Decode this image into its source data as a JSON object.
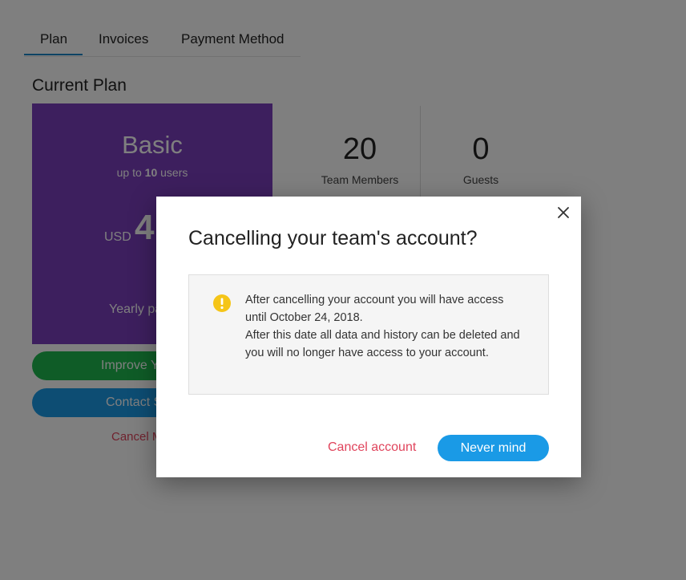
{
  "tabs": [
    {
      "label": "Plan",
      "active": true
    },
    {
      "label": "Invoices",
      "active": false
    },
    {
      "label": "Payment Method",
      "active": false
    }
  ],
  "section_title": "Current Plan",
  "plan": {
    "name": "Basic",
    "limit_prefix": "up to",
    "limit_value": "10",
    "limit_suffix": "users",
    "currency": "USD",
    "price_visible": "4",
    "billing_visible": "Yearly pa",
    "color": "#7b3fbd"
  },
  "actions": {
    "improve_visible": "Improve Y",
    "contact_visible": "Contact S",
    "cancel_visible": "Cancel M"
  },
  "stats": [
    {
      "value": "20",
      "label": "Team Members"
    },
    {
      "value": "0",
      "label": "Guests"
    }
  ],
  "modal": {
    "title": "Cancelling your team's account?",
    "notice_lines": [
      "After cancelling your account you will have access",
      "until October 24, 2018.",
      "After this date all data and history can be deleted and",
      "you will no longer have access to your account."
    ],
    "cancel_label": "Cancel account",
    "confirm_label": "Never mind",
    "close_icon": "close-icon",
    "warning_icon": "warning-icon",
    "warning_color": "#f5c518",
    "danger_color": "#e0445c",
    "accent_color": "#1a9ae6"
  }
}
